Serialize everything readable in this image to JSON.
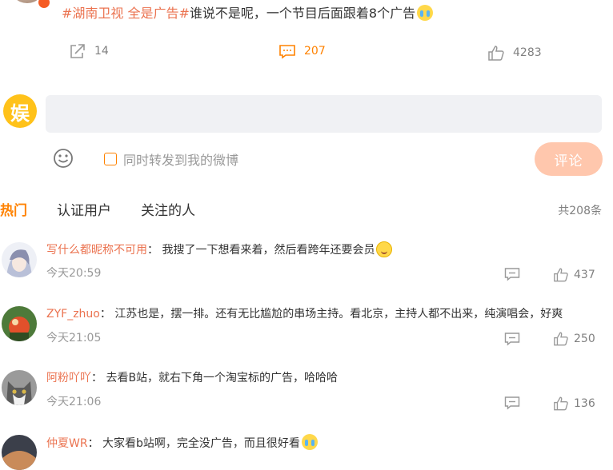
{
  "post": {
    "hashtag": "#湖南卫视 全是广告#",
    "text": "谁说不是呢，一个节目后面跟着8个广告",
    "emoji": "crying-face",
    "share_count": "14",
    "comment_count": "207",
    "like_count": "4283"
  },
  "composer": {
    "logo_char": "娱",
    "repost_label": "同时转发到我的微博",
    "submit_label": "评论"
  },
  "tabs": [
    {
      "label": "热门",
      "active": true
    },
    {
      "label": "认证用户",
      "active": false
    },
    {
      "label": "关注的人",
      "active": false
    }
  ],
  "total": "共208条",
  "comments": [
    {
      "user": "写什么都昵称不可用",
      "sep": "：",
      "text": "我搜了一下想看来着，然后看跨年还要会员",
      "emoji": "smile-face",
      "time": "今天20:59",
      "likes": "437"
    },
    {
      "user": "ZYF_zhuo",
      "sep": "：",
      "text": "江苏也是，摆一排。还有无比尴尬的串场主持。看北京，主持人都不出来，纯演唱会，好爽",
      "emoji": "",
      "time": "今天21:05",
      "likes": "250"
    },
    {
      "user": "阿粉吖吖",
      "sep": "：",
      "text": "去看B站，就右下角一个淘宝标的广告，哈哈哈",
      "emoji": "",
      "time": "今天21:06",
      "likes": "136"
    },
    {
      "user": "仲夏WR",
      "sep": "：",
      "text": "大家看b站啊，完全没广告，而且很好看",
      "emoji": "crying-face",
      "time": "",
      "likes": ""
    }
  ],
  "colors": {
    "accent": "#ff8200",
    "username": "#eb7350",
    "submit_disabled": "#ffc7ad",
    "input_bg": "#f0f1f4"
  }
}
